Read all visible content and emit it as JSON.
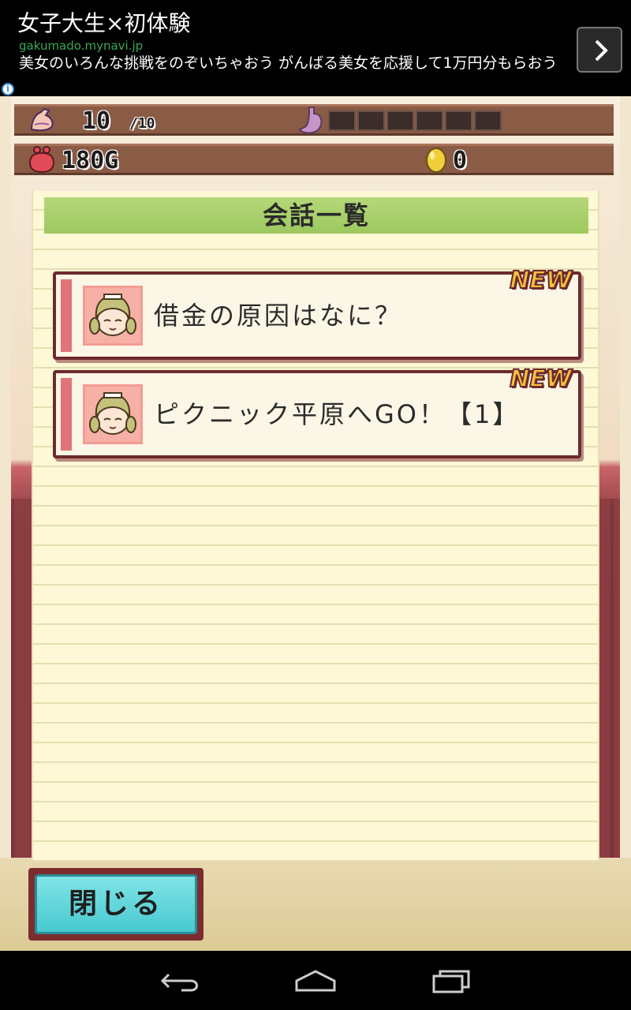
{
  "ad": {
    "title": "女子大生×初体験",
    "url": "gakumado.mynavi.jp",
    "description": "美女のいろんな挑戦をのぞいちゃおう がんばる美女を応援して1万円分もらおう",
    "info_icon": "i"
  },
  "status": {
    "stamina": "10",
    "stamina_max": "/10",
    "hunger_cells_filled": 0,
    "hunger_cells_total": 6,
    "gold": "180G",
    "eggs": "0"
  },
  "dialog": {
    "title": "会話一覧",
    "items": [
      {
        "label": "借金の原因はなに？",
        "badge": "NEW"
      },
      {
        "label": "ピクニック平原へGO！【1】",
        "badge": "NEW"
      }
    ],
    "close_label": "閉じる"
  },
  "colors": {
    "header_green": "#9cc85e",
    "item_border": "#6d2a2c",
    "close_button": "#48c9d0",
    "new_badge": "#f4c13a"
  },
  "icons": {
    "ad_next": "chevron-right-icon",
    "stamina": "flexed-arm-icon",
    "hunger": "stomach-icon",
    "gold": "coin-purse-icon",
    "egg": "golden-egg-icon",
    "nav_back": "back-icon",
    "nav_home": "home-icon",
    "nav_recent": "recent-apps-icon"
  }
}
